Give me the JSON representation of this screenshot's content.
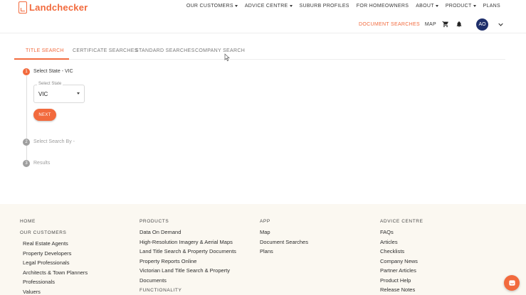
{
  "brand": {
    "name": "Landchecker",
    "accent": "#f26a3d"
  },
  "nav": {
    "items": [
      {
        "label": "OUR CUSTOMERS",
        "dropdown": true
      },
      {
        "label": "ADVICE CENTRE",
        "dropdown": true
      },
      {
        "label": "SUBURB PROFILES",
        "dropdown": false
      },
      {
        "label": "FOR HOMEOWNERS",
        "dropdown": false
      },
      {
        "label": "ABOUT",
        "dropdown": true
      },
      {
        "label": "PRODUCT",
        "dropdown": true
      },
      {
        "label": "PLANS",
        "dropdown": false
      }
    ]
  },
  "subnav": {
    "document_searches": "DOCUMENT SEARCHES",
    "map": "MAP",
    "cart_icon": "cart-icon",
    "bell_icon": "bell-icon",
    "avatar_initials": "AO"
  },
  "tabs": [
    {
      "label": "TITLE SEARCH",
      "active": true
    },
    {
      "label": "CERTIFICATE SEARCHES",
      "active": false
    },
    {
      "label": "STANDARD SEARCHES",
      "active": false
    },
    {
      "label": "COMPANY SEARCH",
      "active": false
    }
  ],
  "steps": [
    {
      "number": "1",
      "label": "Select State - VIC",
      "active": true
    },
    {
      "number": "2",
      "label": "Select Search By -",
      "active": false
    },
    {
      "number": "3",
      "label": "Results",
      "active": false
    }
  ],
  "state_select": {
    "caption": "Select State",
    "value": "VIC"
  },
  "next_button": "NEXT",
  "footer": {
    "col1": {
      "heading": "HOME",
      "subheading": "OUR CUSTOMERS",
      "links": [
        "Real Estate Agents",
        "Property Developers",
        "Legal Professionals",
        "Architects & Town Planners",
        "Professionals",
        "Valuers"
      ]
    },
    "col2": {
      "heading": "PRODUCTS",
      "links": [
        "Data On Demand",
        "High-Resolution Imagery & Aerial Maps",
        "Land Title Search & Property Documents",
        "Property Reports Online",
        "Victorian Land Title Search & Property",
        "Documents"
      ],
      "subheading": "FUNCTIONALITY"
    },
    "col3": {
      "heading": "APP",
      "links": [
        "Map",
        "Document Searches",
        "Plans"
      ]
    },
    "col4": {
      "heading": "ADVICE CENTRE",
      "links": [
        "FAQs",
        "Articles",
        "Checklists",
        "Company News",
        "Partner Articles",
        "Product Help",
        "Release Notes"
      ]
    }
  }
}
